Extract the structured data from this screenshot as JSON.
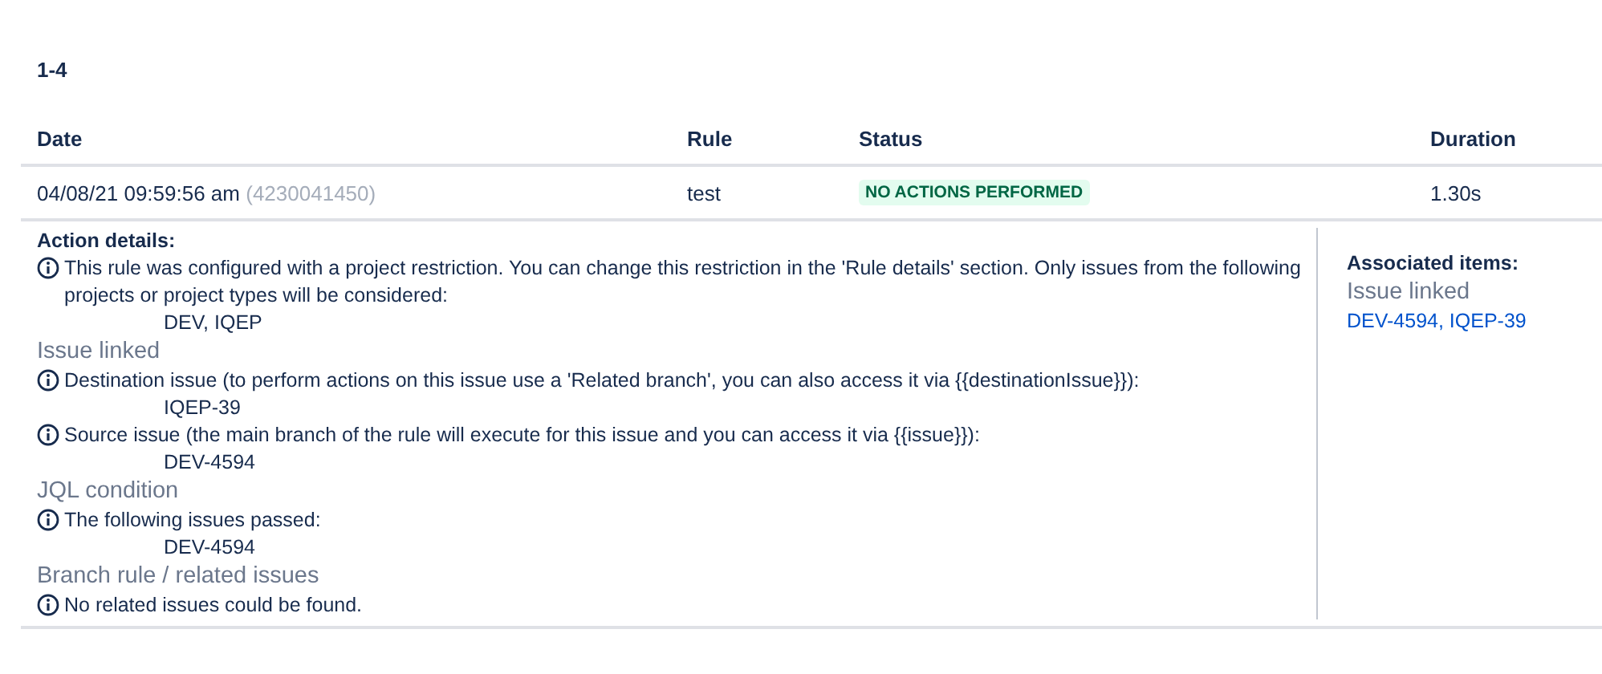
{
  "range": "1-4",
  "table": {
    "columns": [
      "Date",
      "Rule",
      "Status",
      "Duration"
    ],
    "rows": [
      {
        "date": "04/08/21 09:59:56 am",
        "run_id": "(4230041450)",
        "rule": "test",
        "status": "NO ACTIONS PERFORMED",
        "duration": "1.30s",
        "details": {
          "title": "Action details:",
          "entries": [
            {
              "kind": "message",
              "text": "This rule was configured with a project restriction. You can change this restriction in the 'Rule details' section. Only issues from the following projects or project types will be considered:",
              "value": "DEV, IQEP"
            },
            {
              "kind": "heading",
              "text": "Issue linked"
            },
            {
              "kind": "message",
              "text": "Destination issue (to perform actions on this issue use a 'Related branch', you can also access it via {{destinationIssue}}):",
              "value": "IQEP-39"
            },
            {
              "kind": "message",
              "text": "Source issue (the main branch of the rule will execute for this issue and you can access it via {{issue}}):",
              "value": "DEV-4594"
            },
            {
              "kind": "heading",
              "text": "JQL condition"
            },
            {
              "kind": "message",
              "text": "The following issues passed:",
              "value": "DEV-4594"
            },
            {
              "kind": "heading",
              "text": "Branch rule / related issues"
            },
            {
              "kind": "message",
              "text": "No related issues could be found."
            }
          ]
        },
        "associated": {
          "title": "Associated items:",
          "groups": [
            {
              "heading": "Issue linked",
              "links": "DEV-4594, IQEP-39"
            }
          ]
        }
      }
    ]
  }
}
